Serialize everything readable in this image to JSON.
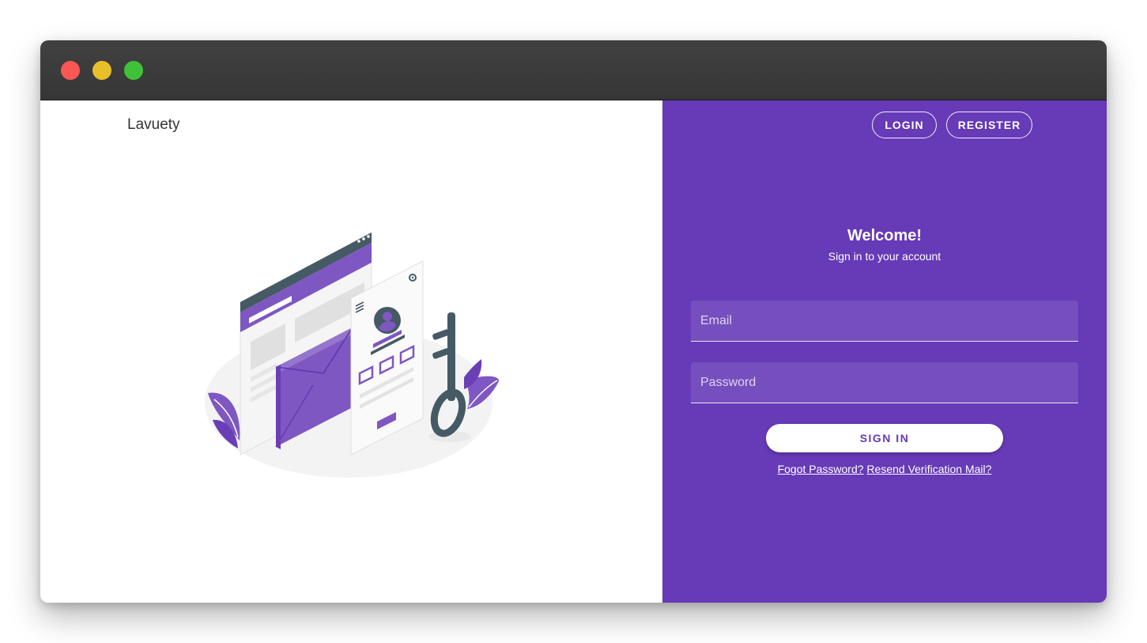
{
  "window": {
    "controls": [
      "close",
      "minimize",
      "maximize"
    ]
  },
  "brand": {
    "name": "Lavuety"
  },
  "nav": {
    "login_label": "LOGIN",
    "register_label": "REGISTER"
  },
  "form": {
    "title": "Welcome!",
    "subtitle": "Sign in to your account",
    "email_placeholder": "Email",
    "email_value": "",
    "password_placeholder": "Password",
    "password_value": "",
    "signin_label": "SIGN IN",
    "forgot_link": "Fogot Password?",
    "resend_link": "Resend Verification Mail?"
  },
  "colors": {
    "accent": "#673ab7",
    "close": "#fc5753",
    "minimize": "#e8bf2a",
    "maximize": "#3fc239"
  }
}
